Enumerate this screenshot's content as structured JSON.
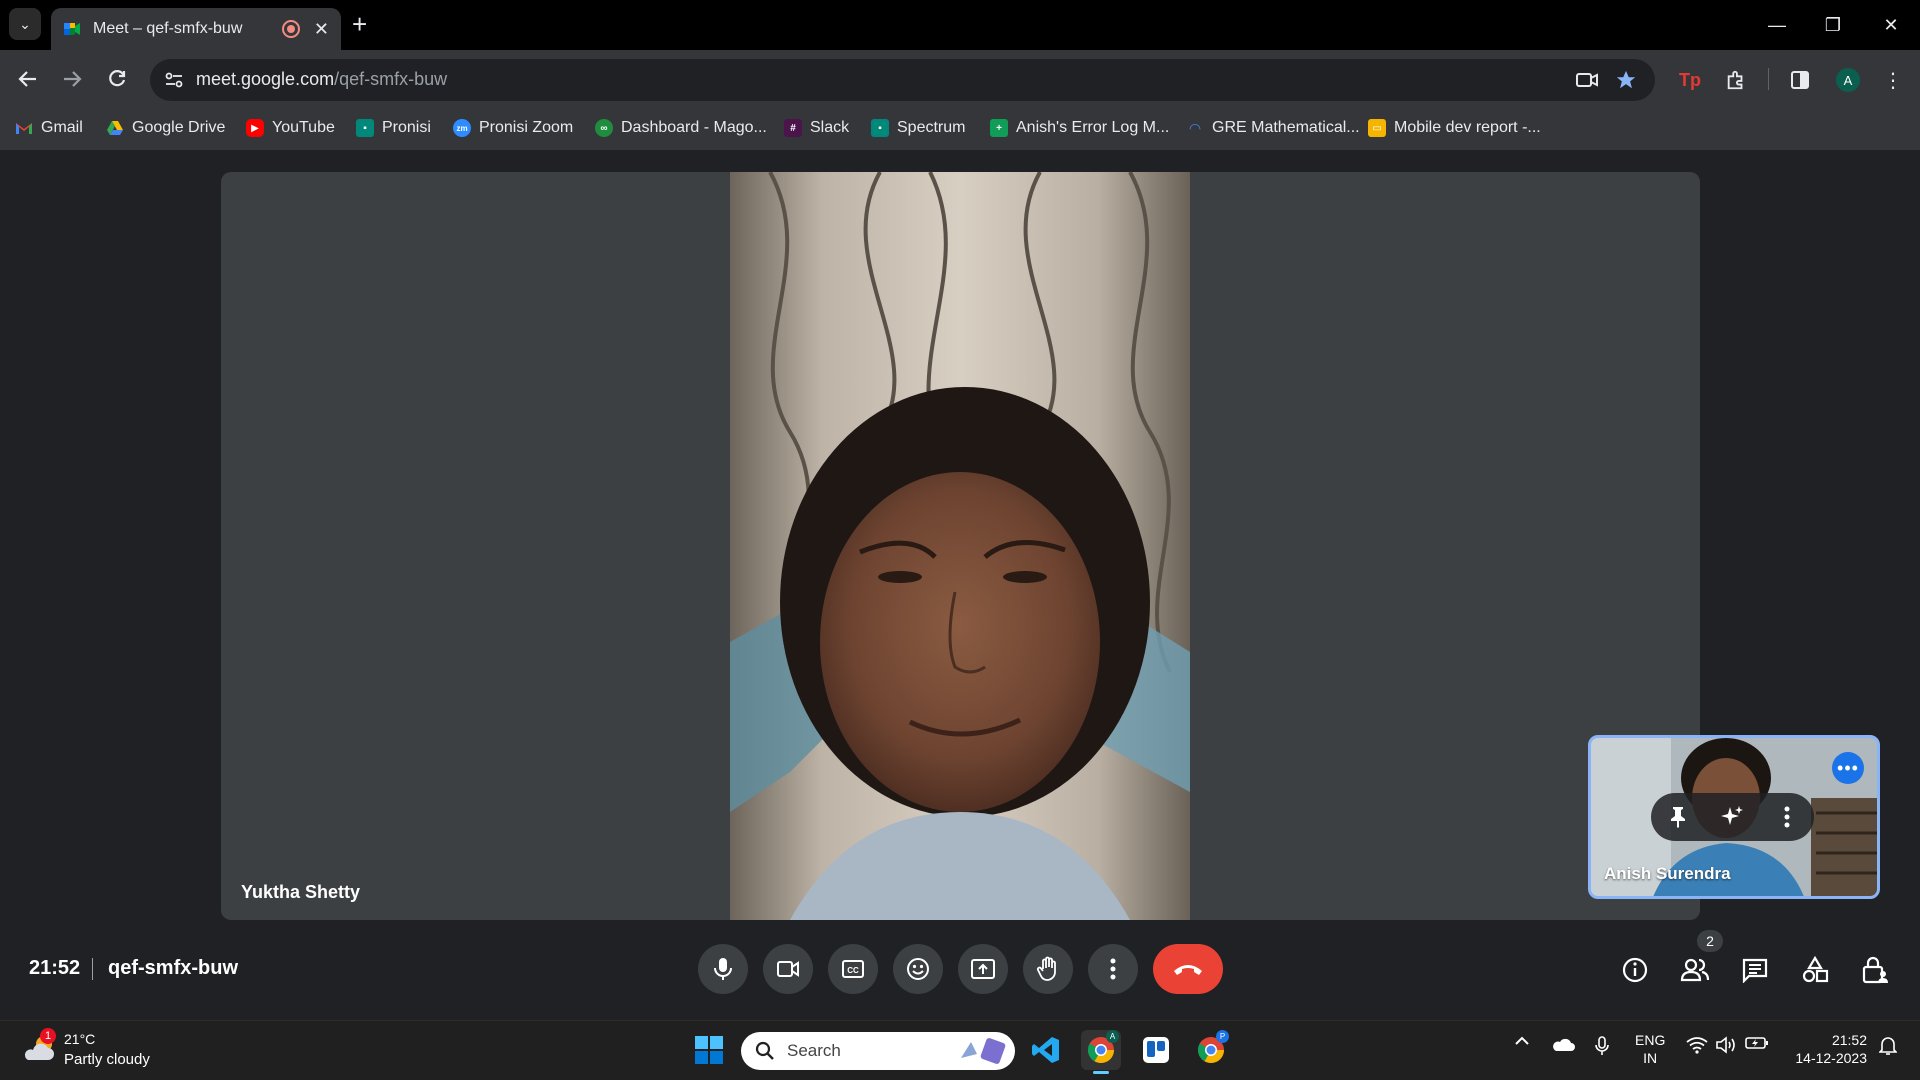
{
  "browser": {
    "tab": {
      "title": "Meet – qef-smfx-buw",
      "recording": true
    },
    "url_host": "meet.google.com",
    "url_path": "/qef-smfx-buw",
    "profile_initial": "A",
    "extension_label": "Tp"
  },
  "bookmarks": [
    {
      "label": "Gmail",
      "icon": "gmail-icon",
      "color": "#ea4335"
    },
    {
      "label": "Google Drive",
      "icon": "drive-icon",
      "color": "#34a853"
    },
    {
      "label": "YouTube",
      "icon": "youtube-icon",
      "color": "#ff0000"
    },
    {
      "label": "Pronisi",
      "icon": "meet-icon",
      "color": "#00897b"
    },
    {
      "label": "Pronisi Zoom",
      "icon": "zoom-icon",
      "color": "#2d8cff"
    },
    {
      "label": "Dashboard - Mago...",
      "icon": "dashboard-icon",
      "color": "#34a853"
    },
    {
      "label": "Slack",
      "icon": "slack-icon",
      "color": "#e01e5a"
    },
    {
      "label": "Spectrum",
      "icon": "meet-icon",
      "color": "#00897b"
    },
    {
      "label": "Anish's Error Log M...",
      "icon": "sheets-icon",
      "color": "#0f9d58"
    },
    {
      "label": "GRE Mathematical...",
      "icon": "gre-icon",
      "color": "#4285f4"
    },
    {
      "label": "Mobile dev report -...",
      "icon": "slides-icon",
      "color": "#f4b400"
    }
  ],
  "meeting": {
    "main_participant": "Yuktha Shetty",
    "self_participant": "Anish Surendra",
    "time": "21:52",
    "code": "qef-smfx-buw",
    "participant_count": "2"
  },
  "taskbar": {
    "weather_temp": "21°C",
    "weather_condition": "Partly cloudy",
    "weather_badge": "1",
    "search_label": "Search",
    "lang_top": "ENG",
    "lang_bottom": "IN",
    "clock_time": "21:52",
    "clock_date": "14-12-2023",
    "chrome_profile_badge_1": "A",
    "chrome_profile_badge_2": "P"
  },
  "colors": {
    "accent": "#8ab4f8",
    "end_call": "#ea4335",
    "meet_bg": "#202124",
    "tile_bg": "#3c4043"
  }
}
